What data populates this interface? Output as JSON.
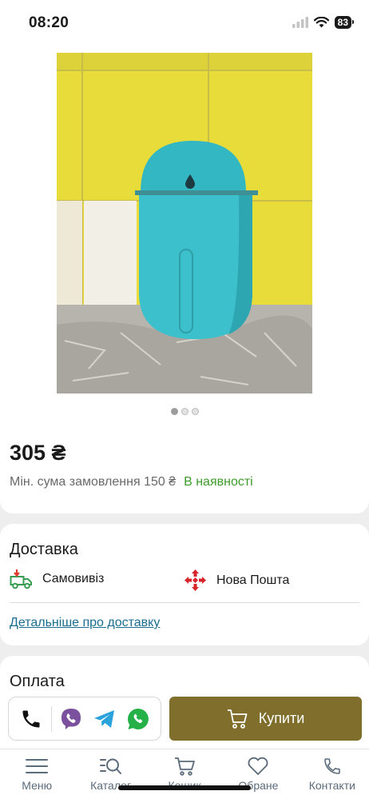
{
  "status_bar": {
    "time": "08:20",
    "battery": "83"
  },
  "gallery": {
    "slides": 3,
    "active_slide": 1
  },
  "product": {
    "price": "305 ₴",
    "min_order": "Мін. сума замовлення 150 ₴",
    "availability": "В наявності",
    "availability_color": "#3e9b2b"
  },
  "delivery": {
    "title": "Доставка",
    "options": [
      {
        "label": "Самовивіз",
        "icon": "pickup-truck-icon"
      },
      {
        "label": "Нова Пошта",
        "icon": "nova-poshta-icon"
      }
    ],
    "details_link": "Детальніше про доставку"
  },
  "payment": {
    "title": "Оплата"
  },
  "actions": {
    "messengers": [
      "phone-icon",
      "viber-icon",
      "telegram-icon",
      "whatsapp-icon"
    ],
    "buy_label": "Купити",
    "buy_color": "#806f2c"
  },
  "nav": {
    "items": [
      {
        "label": "Меню",
        "icon": "menu-icon"
      },
      {
        "label": "Каталог",
        "icon": "catalog-search-icon"
      },
      {
        "label": "Кошик",
        "icon": "cart-icon"
      },
      {
        "label": "Обране",
        "icon": "heart-icon"
      },
      {
        "label": "Контакти",
        "icon": "phone-icon"
      }
    ]
  }
}
